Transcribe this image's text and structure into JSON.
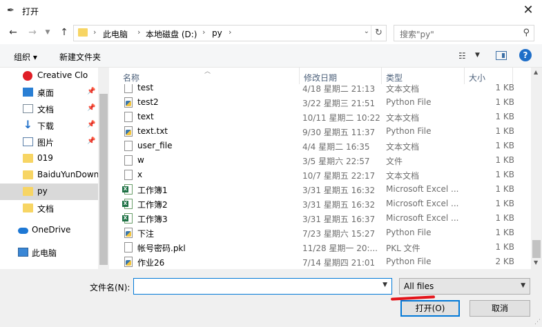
{
  "window": {
    "title": "打开",
    "close_glyph": "✕"
  },
  "nav": {
    "back": "←",
    "forward": "→",
    "recent": "⌄",
    "up": "↑",
    "breadcrumbs": [
      "此电脑",
      "本地磁盘 (D:)",
      "py"
    ],
    "search_placeholder": "搜索\"py\""
  },
  "toolbar": {
    "organize": "组织 ▾",
    "new_folder": "新建文件夹",
    "help": "?"
  },
  "sidebar": {
    "items": [
      {
        "label": "Creative Clo",
        "icon": "creative-cloud-icon",
        "pinned": false
      },
      {
        "label": "桌面",
        "icon": "desktop-icon",
        "pinned": true
      },
      {
        "label": "文档",
        "icon": "documents-icon",
        "pinned": true
      },
      {
        "label": "下载",
        "icon": "download-icon",
        "pinned": true
      },
      {
        "label": "图片",
        "icon": "pictures-icon",
        "pinned": true
      },
      {
        "label": "019",
        "icon": "folder-icon",
        "pinned": false
      },
      {
        "label": "BaiduYunDown",
        "icon": "folder-icon",
        "pinned": false
      },
      {
        "label": "py",
        "icon": "folder-icon",
        "pinned": false,
        "selected": true
      },
      {
        "label": "文档",
        "icon": "folder-icon",
        "pinned": false
      },
      {
        "label": "OneDrive",
        "icon": "onedrive-icon",
        "pinned": false
      },
      {
        "label": "此电脑",
        "icon": "this-pc-icon",
        "pinned": false
      }
    ]
  },
  "columns": {
    "name": "名称",
    "date": "修改日期",
    "type": "类型",
    "size": "大小"
  },
  "files": [
    {
      "name": "test",
      "date": "4/18 星期二 21:13",
      "type": "文本文档",
      "size": "1 KB",
      "icon": "text"
    },
    {
      "name": "test2",
      "date": "3/22 星期三 21:51",
      "type": "Python File",
      "size": "1 KB",
      "icon": "py"
    },
    {
      "name": "text",
      "date": "10/11 星期二 10:22",
      "type": "文本文档",
      "size": "1 KB",
      "icon": "text"
    },
    {
      "name": "text.txt",
      "date": "9/30 星期五 11:37",
      "type": "Python File",
      "size": "1 KB",
      "icon": "py"
    },
    {
      "name": "user_file",
      "date": "4/4 星期二 16:35",
      "type": "文本文档",
      "size": "1 KB",
      "icon": "text"
    },
    {
      "name": "w",
      "date": "3/5 星期六 22:57",
      "type": "文件",
      "size": "1 KB",
      "icon": "blank"
    },
    {
      "name": "x",
      "date": "10/7 星期五 22:17",
      "type": "文本文档",
      "size": "1 KB",
      "icon": "text"
    },
    {
      "name": "工作簿1",
      "date": "3/31 星期五 16:32",
      "type": "Microsoft Excel ...",
      "size": "1 KB",
      "icon": "xls"
    },
    {
      "name": "工作簿2",
      "date": "3/31 星期五 16:32",
      "type": "Microsoft Excel ...",
      "size": "1 KB",
      "icon": "xls"
    },
    {
      "name": "工作簿3",
      "date": "3/31 星期五 16:37",
      "type": "Microsoft Excel ...",
      "size": "1 KB",
      "icon": "xls"
    },
    {
      "name": "下注",
      "date": "7/23 星期六 15:27",
      "type": "Python File",
      "size": "1 KB",
      "icon": "py"
    },
    {
      "name": "帐号密码.pkl",
      "date": "11/28 星期一 20:...",
      "type": "PKL 文件",
      "size": "1 KB",
      "icon": "blank"
    },
    {
      "name": "作业26",
      "date": "7/14 星期四 21:01",
      "type": "Python File",
      "size": "2 KB",
      "icon": "py"
    }
  ],
  "footer": {
    "filename_label": "文件名(N):",
    "filename_value": "",
    "filter": "All files",
    "open_button": "打开(O)",
    "cancel_button": "取消"
  }
}
